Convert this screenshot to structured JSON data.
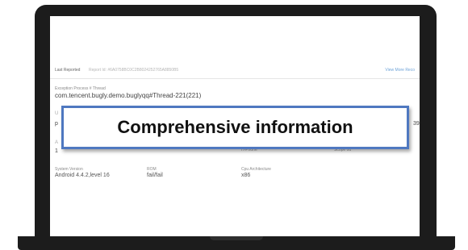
{
  "report": {
    "last_reported_label": "Last Reported",
    "report_id": "Report Id: #6A0758BC0C2B8024252765A8850B5",
    "view_more_label": "View More Reco"
  },
  "thread": {
    "label": "Exception Process # Thread",
    "value": "com.tencent.bugly.demo.buglyqq#Thread-221(221)"
  },
  "fragments": {
    "a": "U",
    "b": "p",
    "c": "A",
    "d": "1",
    "e": "H-Phone",
    "f": "Scope 0d",
    "g": "39"
  },
  "system_version": {
    "label": "System Version",
    "value": "Android 4.4.2,level 16"
  },
  "rom": {
    "label": "ROM",
    "value": "fail/fail"
  },
  "cpu_architecture": {
    "label": "Cpu Architecture",
    "value": "x86"
  },
  "callout": {
    "text": "Comprehensive information"
  },
  "colors": {
    "callout_border": "#4f78c0",
    "link": "#6ea3d8",
    "laptop_frame": "#1c1c1c"
  }
}
